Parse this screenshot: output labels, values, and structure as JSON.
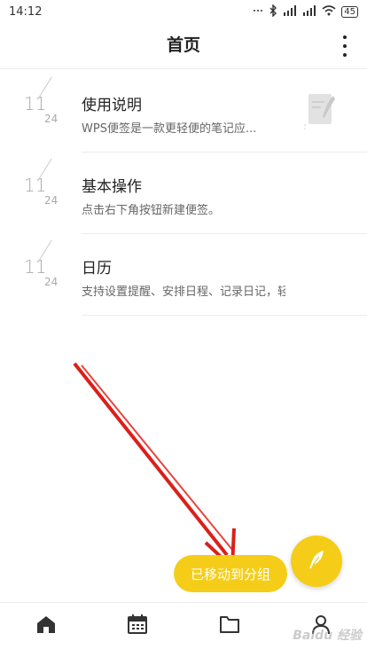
{
  "status_bar": {
    "time": "14:12",
    "battery": "45"
  },
  "header": {
    "title": "首页"
  },
  "notes": [
    {
      "day": "11",
      "month": "24",
      "title": "使用说明",
      "preview": "WPS便签是一款更轻便的笔记应..."
    },
    {
      "day": "11",
      "month": "24",
      "title": "基本操作",
      "preview": "点击右下角按钮新建便签。"
    },
    {
      "day": "11",
      "month": "24",
      "title": "日历",
      "preview": "支持设置提醒、安排日程、记录日记，轻松..."
    }
  ],
  "toast": {
    "text": "已移动到分组"
  },
  "watermark": {
    "text": "Baidu 经验"
  },
  "colors": {
    "accent": "#f5cd18",
    "annotation_arrow": "#d9211b"
  },
  "icons": {
    "fab": "feather-icon",
    "nav": [
      "home-icon",
      "calendar-icon",
      "folder-icon",
      "user-icon"
    ]
  }
}
